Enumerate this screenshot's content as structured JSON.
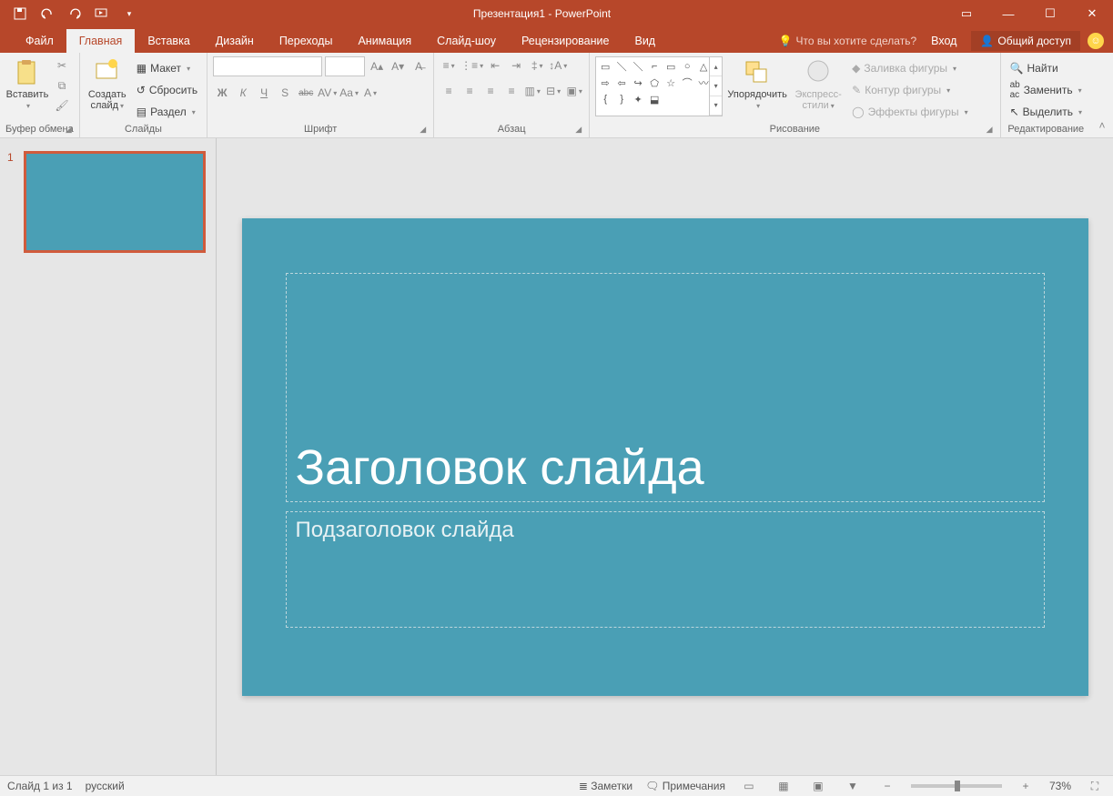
{
  "title": "Презентация1 - PowerPoint",
  "qat": {
    "save": "save-icon",
    "undo": "undo-icon",
    "redo": "redo-icon",
    "startShow": "start-show-icon",
    "customize": "▾"
  },
  "windowControls": {
    "ribbonOpts": "▭",
    "minimize": "—",
    "maximize": "☐",
    "close": "✕"
  },
  "tabs": {
    "file": "Файл",
    "home": "Главная",
    "insert": "Вставка",
    "design": "Дизайн",
    "transitions": "Переходы",
    "animations": "Анимация",
    "slideshow": "Слайд-шоу",
    "review": "Рецензирование",
    "view": "Вид"
  },
  "tellme": "Что вы хотите сделать?",
  "signin": "Вход",
  "share": "Общий доступ",
  "ribbonCollapse": "˄",
  "groups": {
    "clipboard": {
      "label": "Буфер обмена",
      "paste": "Вставить"
    },
    "slides": {
      "label": "Слайды",
      "newSlide": "Создать слайд",
      "layout": "Макет",
      "reset": "Сбросить",
      "section": "Раздел"
    },
    "font": {
      "label": "Шрифт",
      "fontName": "",
      "fontSize": "",
      "bold": "Ж",
      "italic": "К",
      "underline": "Ч",
      "shadow": "S",
      "strike": "abc",
      "spacing": "AV",
      "case": "Aa",
      "color": "A"
    },
    "paragraph": {
      "label": "Абзац"
    },
    "drawing": {
      "label": "Рисование",
      "arrange": "Упорядочить",
      "quickStyles": "Экспресс-стили",
      "shapeFill": "Заливка фигуры",
      "shapeOutline": "Контур фигуры",
      "shapeEffects": "Эффекты фигуры"
    },
    "editing": {
      "label": "Редактирование",
      "find": "Найти",
      "replace": "Заменить",
      "select": "Выделить"
    }
  },
  "thumbnails": [
    {
      "num": "1"
    }
  ],
  "slide": {
    "titlePlaceholder": "Заголовок слайда",
    "subtitlePlaceholder": "Подзаголовок слайда"
  },
  "status": {
    "slideInfo": "Слайд 1 из 1",
    "language": "русский",
    "notes": "Заметки",
    "comments": "Примечания",
    "zoom": "73%"
  }
}
